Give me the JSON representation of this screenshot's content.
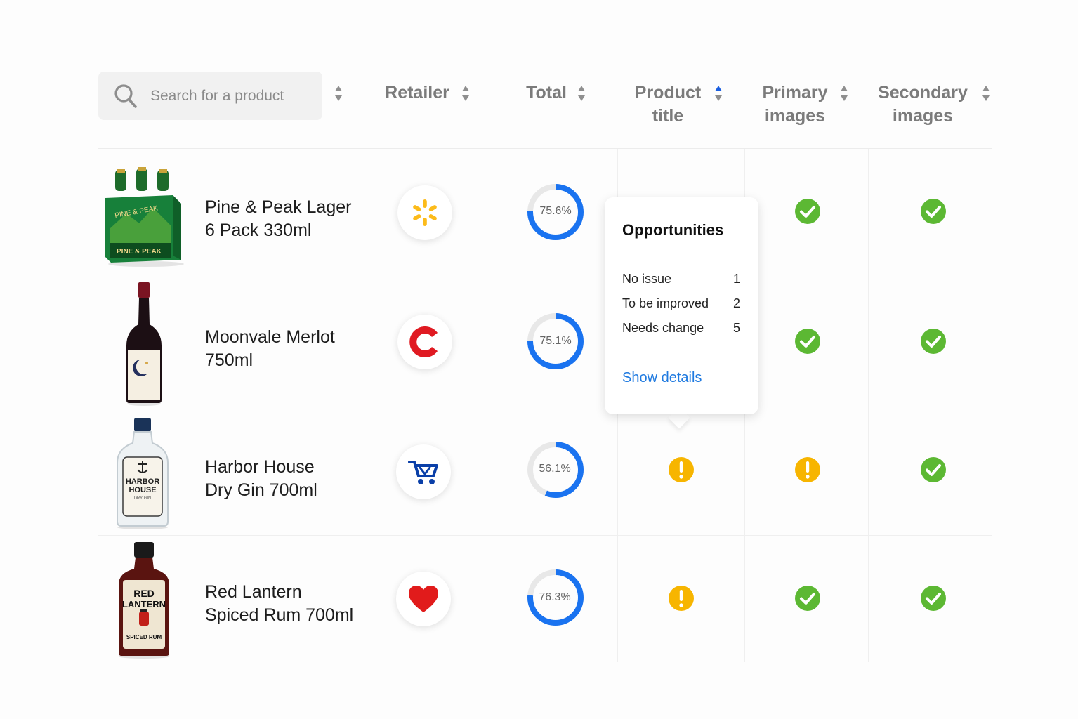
{
  "search": {
    "placeholder": "Search for a product",
    "icon": "search-icon"
  },
  "columns": {
    "retailer": "Retailer",
    "total": "Total",
    "product_title": [
      "Product",
      "title"
    ],
    "primary_images": [
      "Primary",
      "images"
    ],
    "secondary_images": [
      "Secondary",
      "images"
    ]
  },
  "colors": {
    "accent_blue": "#1a73f0",
    "ok_green": "#5cb833",
    "warn_yellow": "#f7b500",
    "link_blue": "#1f7ae0"
  },
  "rows": [
    {
      "name_line1": "Pine & Peak Lager",
      "name_line2": "6 Pack 330ml",
      "image": "beer-six-pack",
      "label_text": [
        "PINE & PEAK",
        "PINE & PEAK"
      ],
      "retailer_icon": "walmart-spark-icon",
      "total": "75.6%",
      "total_value": 75.6,
      "product_title": "hidden",
      "primary_images": "ok",
      "secondary_images": "ok"
    },
    {
      "name_line1": "Moonvale Merlot",
      "name_line2": "750ml",
      "image": "wine-bottle",
      "retailer_icon": "coles-c-icon",
      "total": "75.1%",
      "total_value": 75.1,
      "product_title": "hidden",
      "primary_images": "ok",
      "secondary_images": "ok"
    },
    {
      "name_line1": "Harbor House",
      "name_line2": "Dry Gin 700ml",
      "image": "gin-bottle",
      "label_text": [
        "HARBOR",
        "HOUSE",
        "DRY GIN"
      ],
      "retailer_icon": "shopping-cart-icon",
      "total": "56.1%",
      "total_value": 56.1,
      "product_title": "warning",
      "primary_images": "warning",
      "secondary_images": "ok"
    },
    {
      "name_line1": "Red Lantern",
      "name_line2": "Spiced Rum 700ml",
      "image": "rum-bottle",
      "label_text": [
        "RED",
        "LANTERN",
        "SPICED RUM"
      ],
      "retailer_icon": "heart-icon",
      "total": "76.3%",
      "total_value": 76.3,
      "product_title": "warning",
      "primary_images": "ok",
      "secondary_images": "ok"
    }
  ],
  "popover": {
    "title": "Opportunities",
    "items": [
      {
        "label": "No issue",
        "count": "1"
      },
      {
        "label": "To be improved",
        "count": "2"
      },
      {
        "label": "Needs change",
        "count": "5"
      }
    ],
    "link": "Show details"
  }
}
